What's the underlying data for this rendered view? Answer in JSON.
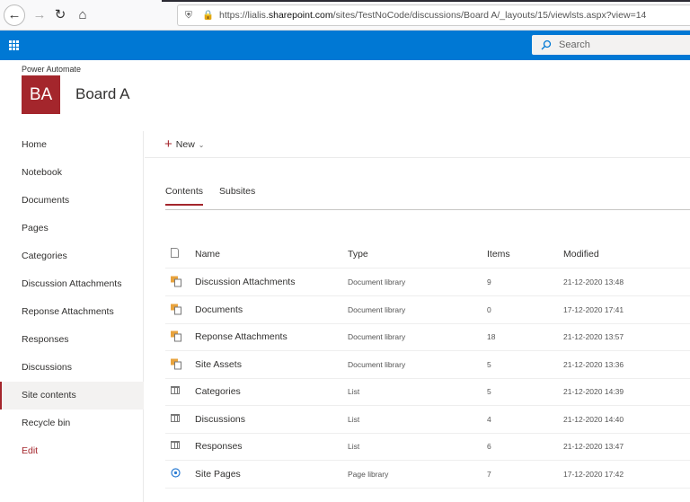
{
  "browser": {
    "url_prefix": "https://lialis.",
    "url_domain": "sharepoint.com",
    "url_path": "/sites/TestNoCode/discussions/Board A/_layouts/15/viewlsts.aspx?view=14"
  },
  "suite": {
    "search_placeholder": "Search"
  },
  "site": {
    "brand": "Power Automate",
    "logo_initials": "BA",
    "title": "Board A",
    "logo_color": "#a4262c"
  },
  "sidebar": {
    "items": [
      {
        "label": "Home"
      },
      {
        "label": "Notebook"
      },
      {
        "label": "Documents"
      },
      {
        "label": "Pages"
      },
      {
        "label": "Categories"
      },
      {
        "label": "Discussion Attachments"
      },
      {
        "label": "Reponse Attachments"
      },
      {
        "label": "Responses"
      },
      {
        "label": "Discussions"
      },
      {
        "label": "Site contents",
        "selected": true
      },
      {
        "label": "Recycle bin"
      },
      {
        "label": "Edit"
      }
    ]
  },
  "commandbar": {
    "new_label": "New"
  },
  "tabs": [
    {
      "label": "Contents",
      "active": true
    },
    {
      "label": "Subsites"
    }
  ],
  "table": {
    "headers": {
      "name": "Name",
      "type": "Type",
      "items": "Items",
      "modified": "Modified"
    },
    "rows": [
      {
        "icon": "document-library-icon",
        "name": "Discussion Attachments",
        "type": "Document library",
        "items": "9",
        "modified": "21-12-2020 13:48"
      },
      {
        "icon": "document-library-icon",
        "name": "Documents",
        "type": "Document library",
        "items": "0",
        "modified": "17-12-2020 17:41"
      },
      {
        "icon": "document-library-icon",
        "name": "Reponse Attachments",
        "type": "Document library",
        "items": "18",
        "modified": "21-12-2020 13:57"
      },
      {
        "icon": "document-library-icon",
        "name": "Site Assets",
        "type": "Document library",
        "items": "5",
        "modified": "21-12-2020 13:36"
      },
      {
        "icon": "list-icon",
        "name": "Categories",
        "type": "List",
        "items": "5",
        "modified": "21-12-2020 14:39"
      },
      {
        "icon": "list-icon",
        "name": "Discussions",
        "type": "List",
        "items": "4",
        "modified": "21-12-2020 14:40"
      },
      {
        "icon": "list-icon",
        "name": "Responses",
        "type": "List",
        "items": "6",
        "modified": "21-12-2020 13:47"
      },
      {
        "icon": "page-library-icon",
        "name": "Site Pages",
        "type": "Page library",
        "items": "7",
        "modified": "17-12-2020 17:42"
      }
    ]
  }
}
